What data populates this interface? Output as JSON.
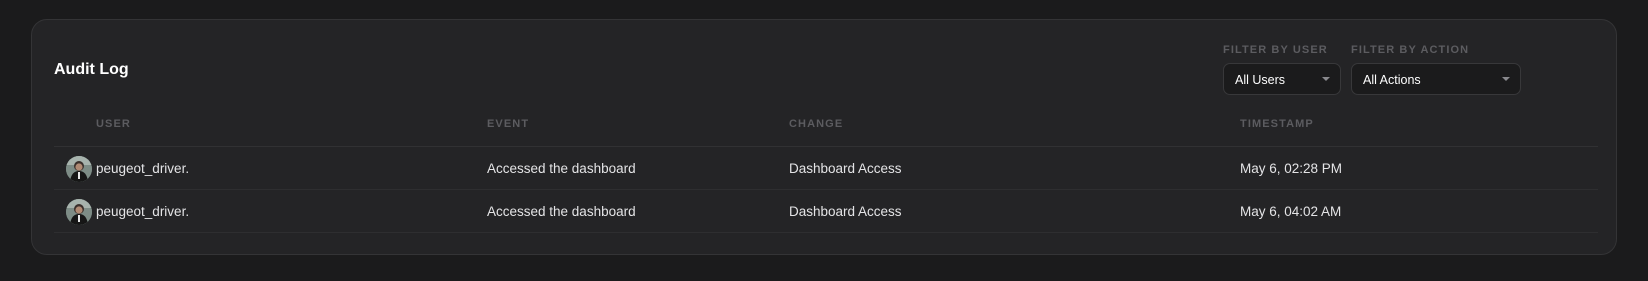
{
  "audit_log": {
    "title": "Audit Log",
    "filters": {
      "user": {
        "label": "FILTER BY USER",
        "selected": "All Users",
        "icon": "chevron-down-icon"
      },
      "action": {
        "label": "FILTER BY ACTION",
        "selected": "All Actions",
        "icon": "chevron-down-icon"
      }
    },
    "table": {
      "columns": [
        "USER",
        "EVENT",
        "CHANGE",
        "TIMESTAMP"
      ],
      "rows": [
        {
          "avatar": "user-avatar",
          "user": "peugeot_driver.",
          "event": "Accessed the dashboard",
          "change": "Dashboard Access",
          "timestamp": "May 6, 02:28 PM"
        },
        {
          "avatar": "user-avatar",
          "user": "peugeot_driver.",
          "event": "Accessed the dashboard",
          "change": "Dashboard Access",
          "timestamp": "May 6, 04:02 AM"
        }
      ]
    }
  },
  "colors": {
    "page_background": "#1b1b1c",
    "card_background": "#242426",
    "header_text": "#5c5c60",
    "primary_text": "#ffffff"
  }
}
